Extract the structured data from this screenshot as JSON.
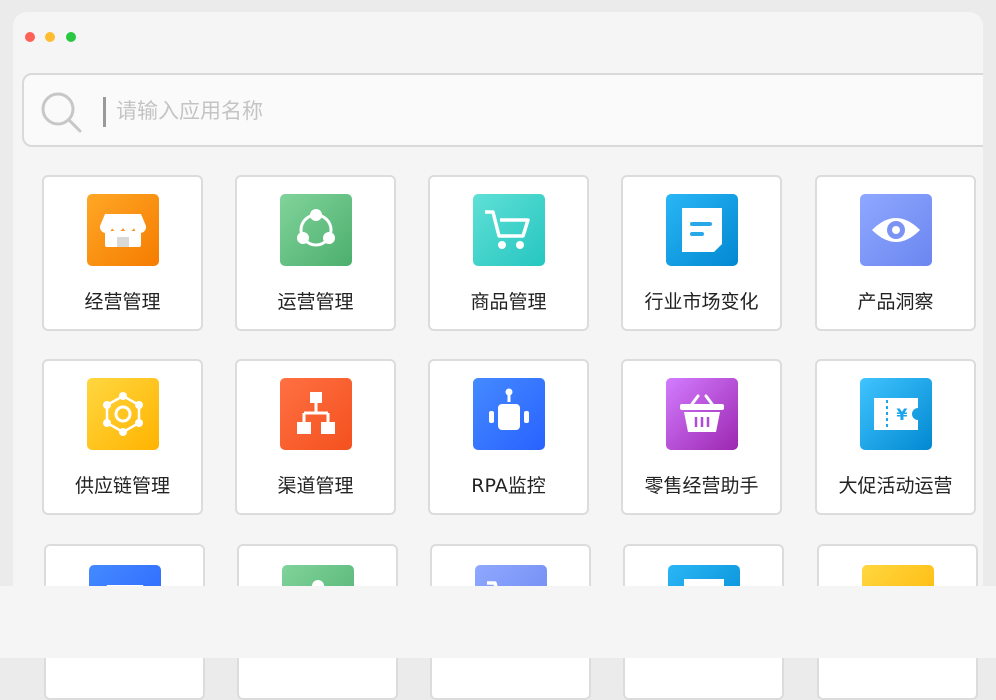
{
  "window_controls": {
    "close_color": "#fe5f57",
    "minimize_color": "#febc2e",
    "maximize_color": "#28c840"
  },
  "search": {
    "placeholder": "请输入应用名称",
    "value": ""
  },
  "apps": [
    {
      "label": "经营管理",
      "icon": "storefront-icon",
      "color_from": "#ffa726",
      "color_to": "#f57c00"
    },
    {
      "label": "运营管理",
      "icon": "share-icon",
      "color_from": "#81d39a",
      "color_to": "#4caf6e"
    },
    {
      "label": "商品管理",
      "icon": "shopping-cart-icon",
      "color_from": "#5fe0d6",
      "color_to": "#26c6c0"
    },
    {
      "label": "行业市场变化",
      "icon": "document-icon",
      "color_from": "#29b6f6",
      "color_to": "#0288d1"
    },
    {
      "label": "产品洞察",
      "icon": "eye-icon",
      "color_from": "#8fa8ff",
      "color_to": "#6b86f0"
    },
    {
      "label": "供应链管理",
      "icon": "network-icon",
      "color_from": "#ffd740",
      "color_to": "#ffb300"
    },
    {
      "label": "渠道管理",
      "icon": "org-chart-icon",
      "color_from": "#ff7043",
      "color_to": "#f4511e"
    },
    {
      "label": "RPA监控",
      "icon": "robot-icon",
      "color_from": "#448aff",
      "color_to": "#2962ff"
    },
    {
      "label": "零售经营助手",
      "icon": "basket-icon",
      "color_from": "#d27cff",
      "color_to": "#9c27b0"
    },
    {
      "label": "大促活动运营",
      "icon": "coupon-icon",
      "color_from": "#40c4ff",
      "color_to": "#0288d1"
    },
    {
      "label": "",
      "icon": "storefront-icon",
      "color_from": "#448aff",
      "color_to": "#2962ff"
    },
    {
      "label": "",
      "icon": "share-icon",
      "color_from": "#81d39a",
      "color_to": "#4caf6e"
    },
    {
      "label": "",
      "icon": "shopping-cart-icon",
      "color_from": "#8fa8ff",
      "color_to": "#6b86f0"
    },
    {
      "label": "",
      "icon": "document-icon",
      "color_from": "#29b6f6",
      "color_to": "#0288d1"
    },
    {
      "label": "",
      "icon": "eye-icon",
      "color_from": "#ffd740",
      "color_to": "#ffb300"
    }
  ]
}
